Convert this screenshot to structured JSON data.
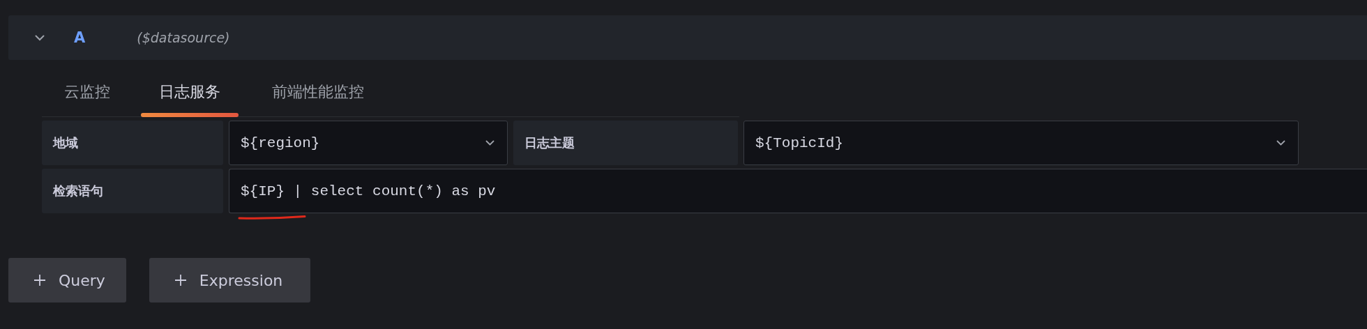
{
  "query": {
    "ref": "A",
    "datasource": "($datasource)",
    "expanded": true
  },
  "tabs": [
    {
      "label": "云监控",
      "selected": false
    },
    {
      "label": "日志服务",
      "selected": true
    },
    {
      "label": "前端性能监控",
      "selected": false
    }
  ],
  "fields": [
    {
      "label": "地域",
      "kind": "select",
      "value": "${region}"
    },
    {
      "label": "日志主题",
      "kind": "select",
      "value": "${TopicId}"
    }
  ],
  "search": {
    "label": "检索语句",
    "value": "${IP} | select count(*) as pv"
  },
  "buttons": [
    {
      "label": "Query"
    },
    {
      "label": "Expression"
    }
  ]
}
